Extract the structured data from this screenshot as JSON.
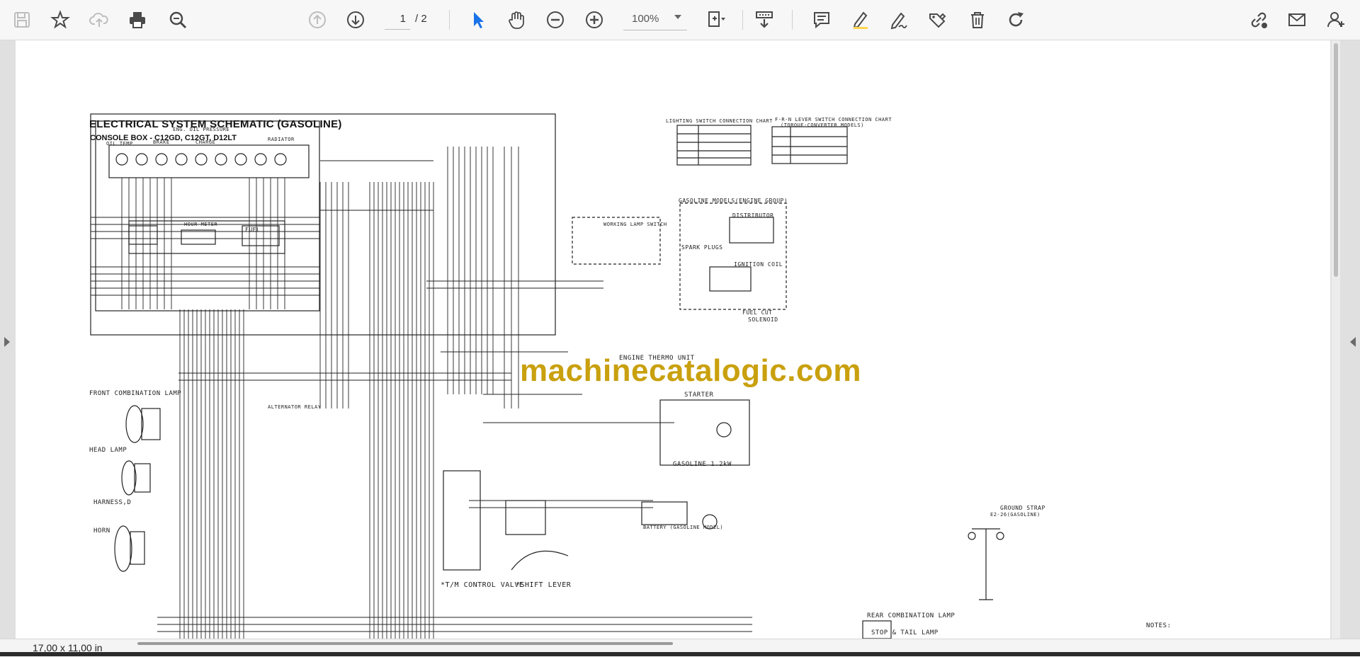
{
  "toolbar": {
    "page_current": "1",
    "page_total": "/ 2",
    "zoom_value": "100%"
  },
  "status": {
    "page_size": "17,00 x 11,00 in"
  },
  "document": {
    "title": "ELECTRICAL SYSTEM SCHEMATIC (GASOLINE)",
    "subtitle": "CONSOLE BOX - C12GD, C12GT, D12LT",
    "watermark": "machinecatalogic.com",
    "labels": {
      "lighting_chart": "LIGHTING SWITCH CONNECTION CHART",
      "fnr_chart": "F-R-N LEVER SWITCH CONNECTION CHART",
      "fnr_chart_sub": "(TORQUE-CONVERTER MODELS)",
      "gasoline_models": "GASOLINE MODELS(ENGINE GROUP)",
      "distributor": "DISTRIBUTOR",
      "spark_plugs": "SPARK PLUGS",
      "ignition_coil": "IGNITION COIL",
      "fuel_cut": "FUEL CUT",
      "solenoid": "SOLENOID",
      "working_lamp_switch": "WORKING LAMP SWITCH",
      "engine_thermo_unit": "ENGINE THERMO UNIT",
      "starter": "STARTER",
      "gasoline_kw": "GASOLINE 1.2kW",
      "battery": "BATTERY (GASOLINE MODEL)",
      "front_combination_lamp": "FRONT COMBINATION LAMP",
      "head_lamp": "HEAD LAMP",
      "harness_d": "HARNESS,D",
      "horn": "HORN",
      "tm_control_valve": "*T/M CONTROL VALVE",
      "shift_lever": "*SHIFT LEVER",
      "ground_strap": "GROUND STRAP",
      "ground_strap_sub": "E2-26(GASOLINE)",
      "rear_combination_lamp": "REAR COMBINATION LAMP",
      "stop_tail_lamp": "STOP & TAIL LAMP",
      "notes": "NOTES:",
      "hour_meter": "HOUR METER",
      "fuel": "FUEL",
      "alternator_relay": "ALTERNATOR RELAY",
      "oil_temp": "OIL TEMP",
      "brake": "BRAKE",
      "eng_oil_pressure": "ENG. OIL PRESSURE",
      "charge": "CHARGE",
      "radiator": "RADIATOR"
    }
  }
}
